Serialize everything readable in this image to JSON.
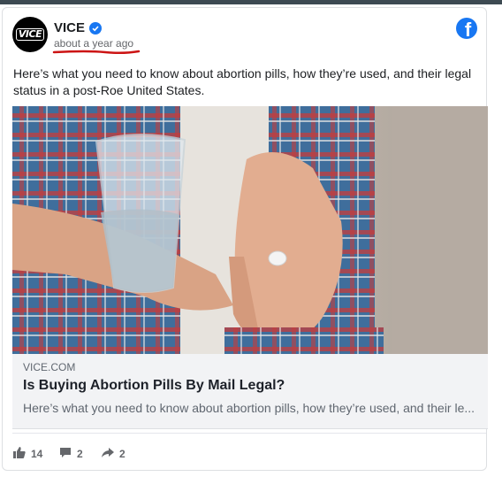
{
  "post": {
    "page_name": "VICE",
    "avatar_text": "VICE",
    "timestamp": "about a year ago",
    "text": "Here’s what you need to know about abortion pills, how they’re used, and their legal status in a post-Roe United States."
  },
  "link": {
    "domain": "VICE.COM",
    "title": "Is Buying Abortion Pills By Mail Legal?",
    "description": "Here’s what you need to know about abortion pills, how they’re used, and their le..."
  },
  "engagement": {
    "likes": "14",
    "comments": "2",
    "shares": "2"
  },
  "colors": {
    "facebook_blue": "#1877f2",
    "annotation_red": "#cc1414"
  },
  "icons": [
    "vice-logo-icon",
    "verified-badge-icon",
    "facebook-icon",
    "like-icon",
    "comment-icon",
    "share-icon"
  ]
}
